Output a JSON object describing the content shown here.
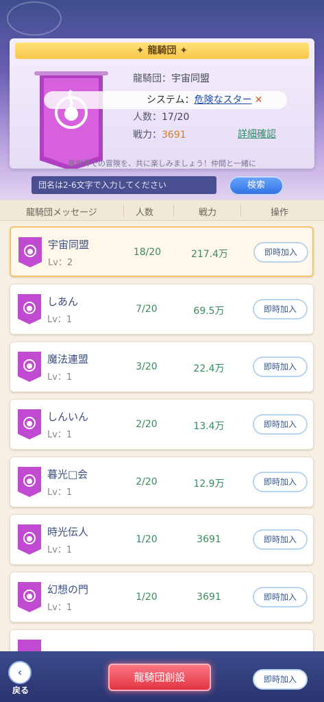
{
  "guild_info": {
    "title": "龍騎団",
    "name_label": "龍騎団：",
    "name_value": "宇宙同盟",
    "members_label": "人数：",
    "members_value": "17/20",
    "power_label": "戦力：",
    "power_value": "3691",
    "detail_link": "詳細確認",
    "description": "異世界での冒険を、共に楽しみましょう！仲間と一緒に"
  },
  "toast": {
    "prefix": "システム：",
    "link": "危険なスター",
    "close": "✕"
  },
  "search": {
    "placeholder": "団名は2-6文字で入力してください",
    "button": "検索"
  },
  "list_header": {
    "message": "龍騎団メッセージ",
    "members": "人数",
    "power": "戦力",
    "action": "操作"
  },
  "rows": [
    {
      "name": "宇宙同盟",
      "lv": "Lv：2",
      "members": "18/20",
      "power": "217.4万",
      "join": "即時加入"
    },
    {
      "name": "しあん",
      "lv": "Lv：1",
      "members": "7/20",
      "power": "69.5万",
      "join": "即時加入"
    },
    {
      "name": "魔法連盟",
      "lv": "Lv：1",
      "members": "3/20",
      "power": "22.4万",
      "join": "即時加入"
    },
    {
      "name": "しんいん",
      "lv": "Lv：1",
      "members": "2/20",
      "power": "13.4万",
      "join": "即時加入"
    },
    {
      "name": "暮光□会",
      "lv": "Lv：1",
      "members": "2/20",
      "power": "12.9万",
      "join": "即時加入"
    },
    {
      "name": "時光伝人",
      "lv": "Lv：1",
      "members": "1/20",
      "power": "3691",
      "join": "即時加入"
    },
    {
      "name": "幻想の門",
      "lv": "Lv：1",
      "members": "1/20",
      "power": "3691",
      "join": "即時加入"
    }
  ],
  "bottom": {
    "back_label": "戻る",
    "create_button": "龍騎団創設",
    "join_button": "即時加入"
  }
}
